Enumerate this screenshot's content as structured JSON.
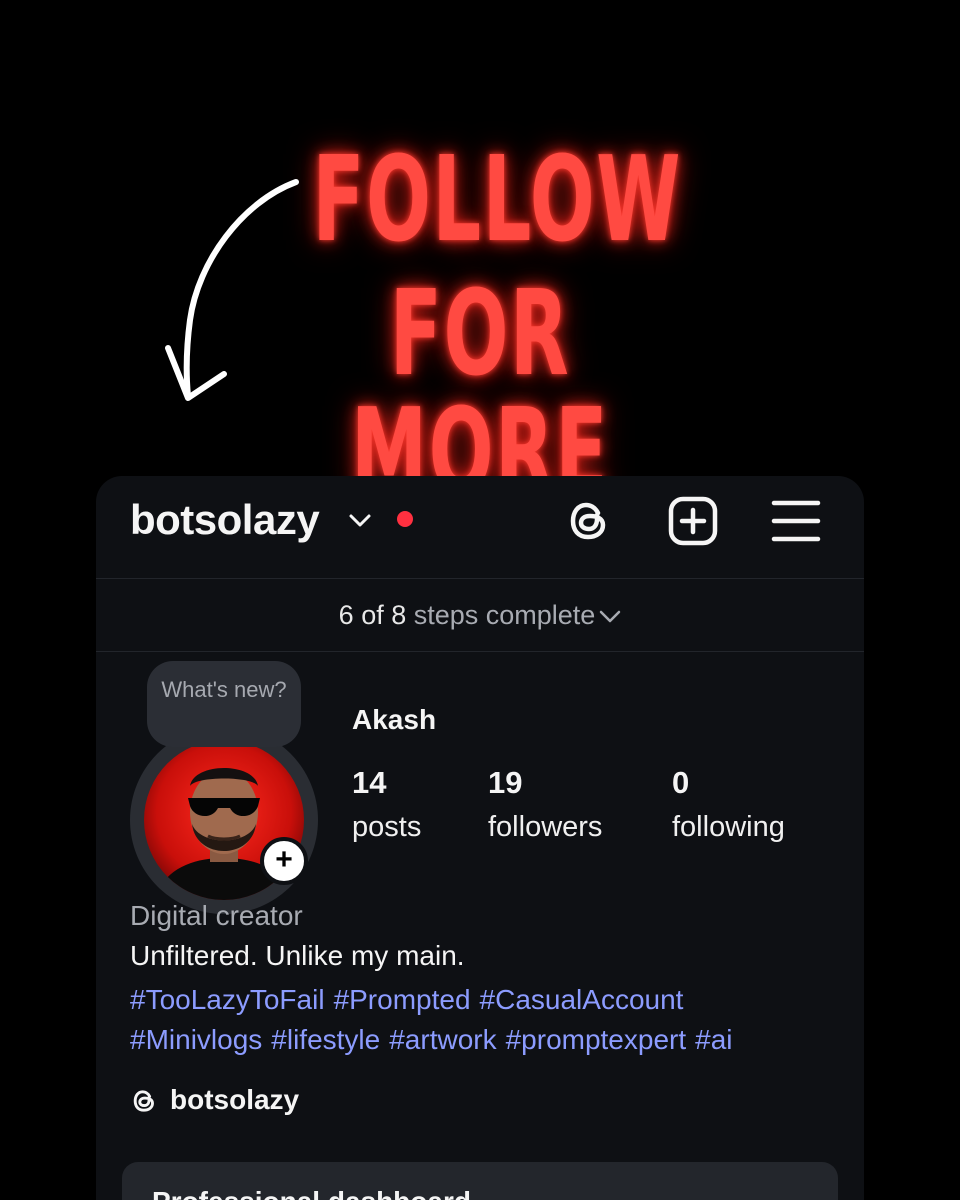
{
  "headline": {
    "line1": "FOLLOW",
    "line2": "FOR MORE",
    "color": "#ff4a42"
  },
  "arrow_icon": "curved-arrow-down-left",
  "profile": {
    "username": "botsolazy",
    "notification_dot_color": "#ff3040",
    "header_icons": [
      "threads-icon",
      "create-plus-icon",
      "hamburger-menu-icon"
    ],
    "steps": {
      "done": "6 of 8",
      "label": "steps complete"
    },
    "story_bubble": "What's new?",
    "display_name": "Akash",
    "stats": {
      "posts": {
        "count": "14",
        "label": "posts"
      },
      "followers": {
        "count": "19",
        "label": "followers"
      },
      "following": {
        "count": "0",
        "label": "following"
      }
    },
    "category": "Digital creator",
    "bio": "Unfiltered. Unlike my main.",
    "hashtags": [
      "#TooLazyToFail",
      "#Prompted",
      "#CasualAccount",
      "#Minivlogs",
      "#lifestyle",
      "#artwork",
      "#promptexpert",
      "#ai"
    ],
    "hashtag_color": "#8c9cff",
    "threads_handle": "botsolazy",
    "dashboard_title": "Professional dashboard"
  }
}
